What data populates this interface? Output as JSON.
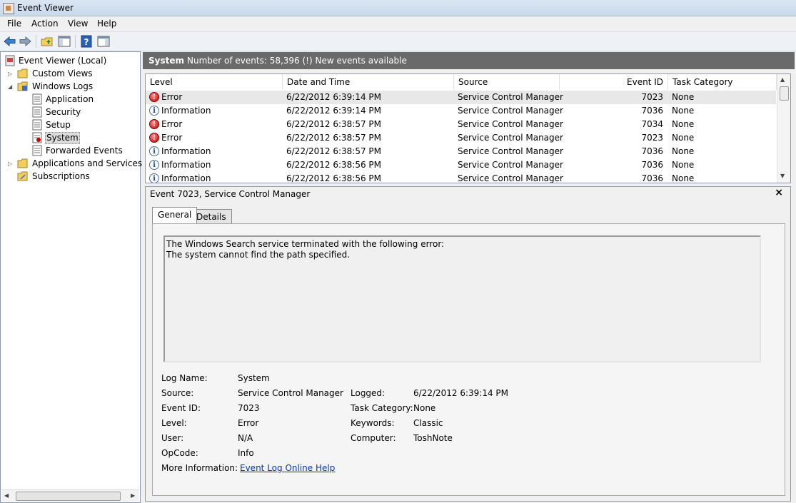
{
  "window": {
    "title": "Event Viewer"
  },
  "menu": [
    "File",
    "Action",
    "View",
    "Help"
  ],
  "tree": {
    "root": "Event Viewer (Local)",
    "custom_views": "Custom Views",
    "windows_logs": "Windows Logs",
    "application": "Application",
    "security": "Security",
    "setup": "Setup",
    "system": "System",
    "forwarded": "Forwarded Events",
    "apps_services": "Applications and Services Lo",
    "subscriptions": "Subscriptions"
  },
  "log_header": {
    "name": "System",
    "count": "Number of events: 58,396 (!) New events available"
  },
  "columns": {
    "level": "Level",
    "date": "Date and Time",
    "source": "Source",
    "event_id": "Event ID",
    "task": "Task Category"
  },
  "events": [
    {
      "level": "Error",
      "date": "6/22/2012 6:39:14 PM",
      "source": "Service Control Manager",
      "event_id": "7023",
      "task": "None"
    },
    {
      "level": "Information",
      "date": "6/22/2012 6:39:14 PM",
      "source": "Service Control Manager",
      "event_id": "7036",
      "task": "None"
    },
    {
      "level": "Error",
      "date": "6/22/2012 6:38:57 PM",
      "source": "Service Control Manager",
      "event_id": "7034",
      "task": "None"
    },
    {
      "level": "Error",
      "date": "6/22/2012 6:38:57 PM",
      "source": "Service Control Manager",
      "event_id": "7023",
      "task": "None"
    },
    {
      "level": "Information",
      "date": "6/22/2012 6:38:57 PM",
      "source": "Service Control Manager",
      "event_id": "7036",
      "task": "None"
    },
    {
      "level": "Information",
      "date": "6/22/2012 6:38:56 PM",
      "source": "Service Control Manager",
      "event_id": "7036",
      "task": "None"
    },
    {
      "level": "Information",
      "date": "6/22/2012 6:38:56 PM",
      "source": "Service Control Manager",
      "event_id": "7036",
      "task": "None"
    }
  ],
  "detail": {
    "title": "Event 7023, Service Control Manager",
    "close": "×",
    "tab_general": "General",
    "tab_details": "Details",
    "desc_line1": "The Windows Search service terminated with the following error:",
    "desc_line2": "The system cannot find the path specified.",
    "labels": {
      "log_name": "Log Name:",
      "source": "Source:",
      "event_id": "Event ID:",
      "level": "Level:",
      "user": "User:",
      "opcode": "OpCode:",
      "more_info": "More Information:",
      "logged": "Logged:",
      "task_category": "Task Category:",
      "keywords": "Keywords:",
      "computer": "Computer:"
    },
    "values": {
      "log_name": "System",
      "source": "Service Control Manager",
      "event_id": "7023",
      "level": "Error",
      "user": "N/A",
      "opcode": "Info",
      "more_info": "Event Log Online Help",
      "logged": "6/22/2012 6:39:14 PM",
      "task_category": "None",
      "keywords": "Classic",
      "computer": "ToshNote"
    }
  },
  "icons": {
    "back": "arrow-left-icon",
    "forward": "arrow-right-icon",
    "up": "folder-up-icon",
    "show_hide": "show-hide-tree-icon",
    "help": "help-icon",
    "action_pane": "action-pane-icon",
    "error": "error-icon",
    "info": "information-icon"
  },
  "colors": {
    "header_bg": "#6a6a6a",
    "error_red": "#c00000",
    "info_blue": "#1a4f9c",
    "link": "#0033cc"
  }
}
